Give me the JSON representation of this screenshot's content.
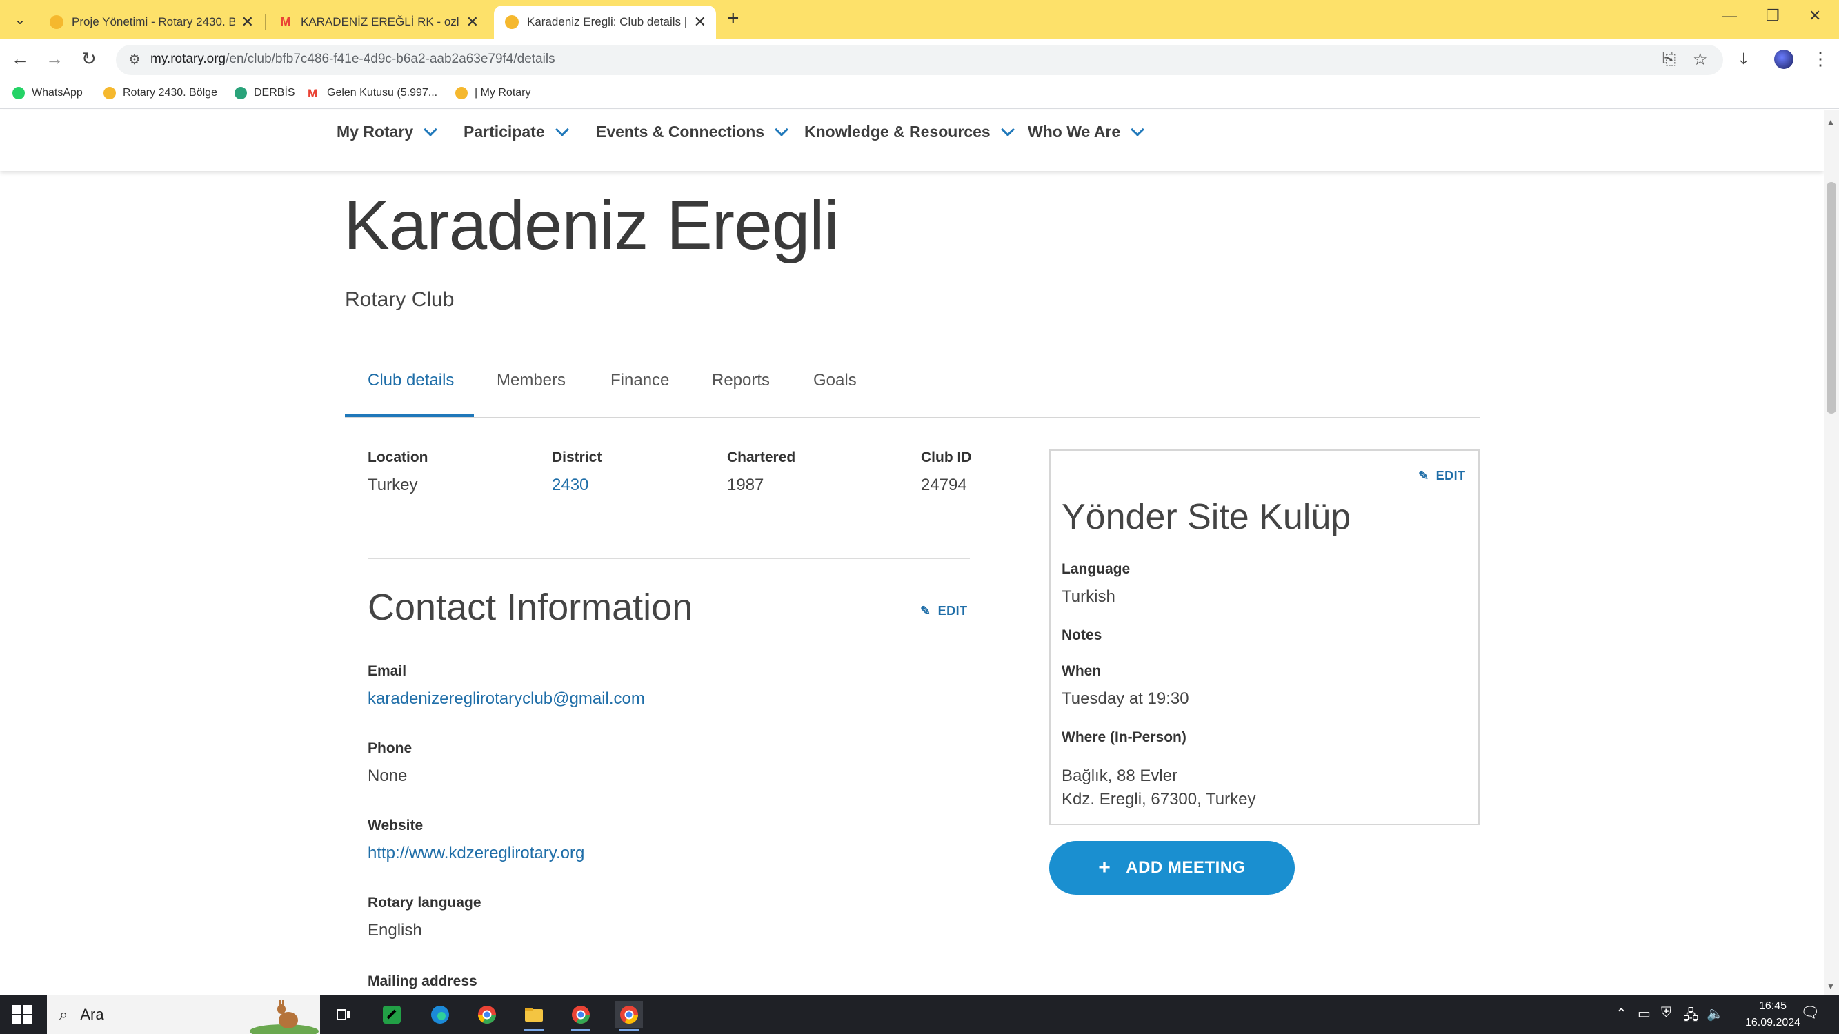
{
  "browser": {
    "tabs": [
      {
        "title": "Proje Yönetimi - Rotary 2430. B",
        "active": false
      },
      {
        "title": "KARADENİZ EREĞLİ RK - ozlem",
        "active": false
      },
      {
        "title": "Karadeniz Eregli: Club details | M",
        "active": true
      }
    ],
    "close_glyph": "✕",
    "new_tab_glyph": "+",
    "url_host": "my.rotary.org",
    "url_path": "/en/club/bfb7c486-f41e-4d9c-b6a2-aab2a63e79f4/details",
    "bookmarks": [
      {
        "label": "WhatsApp",
        "color": "#25d366"
      },
      {
        "label": "Rotary 2430. Bölge",
        "color": "#f5b82e"
      },
      {
        "label": "DERBİS",
        "color": "#2aa37a"
      },
      {
        "label": "Gelen Kutusu (5.997...",
        "color": "#ea4335"
      },
      {
        "label": "| My Rotary",
        "color": "#f5b82e"
      }
    ]
  },
  "site_nav": {
    "items": [
      "My Rotary",
      "Participate",
      "Events & Connections",
      "Knowledge & Resources",
      "Who We Are"
    ]
  },
  "club": {
    "name": "Karadeniz Eregli",
    "type": "Rotary Club",
    "tabs": [
      "Club details",
      "Members",
      "Finance",
      "Reports",
      "Goals"
    ],
    "summary": {
      "location_label": "Location",
      "location": "Turkey",
      "district_label": "District",
      "district": "2430",
      "chartered_label": "Chartered",
      "chartered": "1987",
      "club_id_label": "Club ID",
      "club_id": "24794"
    },
    "contact": {
      "title": "Contact Information",
      "edit_label": "EDIT",
      "email_label": "Email",
      "email": "karadenizereglirotaryclub@gmail.com",
      "phone_label": "Phone",
      "phone": "None",
      "website_label": "Website",
      "website": "http://www.kdzereglirotary.org",
      "language_label": "Rotary language",
      "language": "English",
      "mailing_label": "Mailing address"
    },
    "meeting": {
      "edit_label": "EDIT",
      "name": "Yönder Site Kulüp",
      "language_label": "Language",
      "language": "Turkish",
      "notes_label": "Notes",
      "when_label": "When",
      "when": "Tuesday at 19:30",
      "where_label": "Where (In-Person)",
      "address_line1": "Bağlık, 88 Evler",
      "address_line2": "Kdz. Eregli, 67300, Turkey"
    },
    "add_meeting_label": "ADD MEETING"
  },
  "taskbar": {
    "search_placeholder": "Ara",
    "time": "16:45",
    "date": "16.09.2024"
  },
  "colors": {
    "tabbar": "#fde16a",
    "link": "#1f6ea8",
    "accent": "#1f78ba",
    "button": "#1a8fd0"
  }
}
